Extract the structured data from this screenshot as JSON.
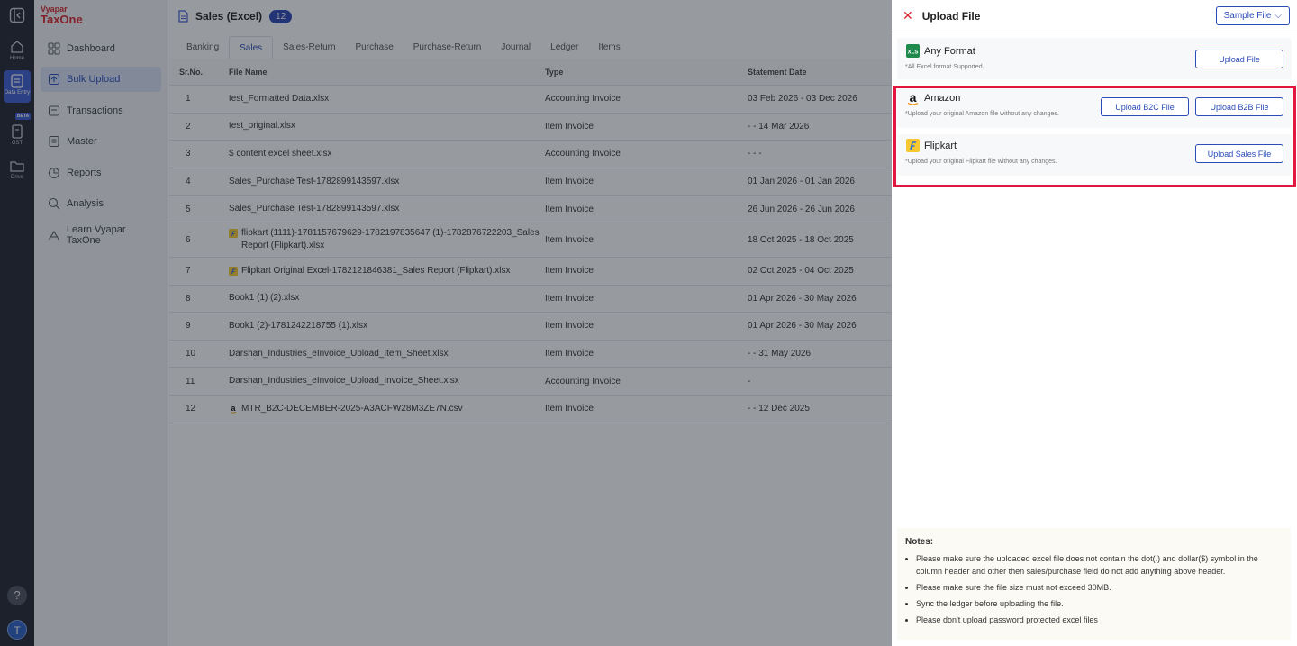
{
  "rail": {
    "items": [
      {
        "label": "Home"
      },
      {
        "label": "Data Entry"
      },
      {
        "label": "GST"
      },
      {
        "label": "Drive"
      }
    ],
    "beta": "BETA",
    "help": "?",
    "avatar": "T"
  },
  "sidebar": {
    "logo_top": "Vyapar",
    "logo_bottom": "TaxOne",
    "items": [
      {
        "label": "Dashboard"
      },
      {
        "label": "Bulk Upload"
      },
      {
        "label": "Transactions"
      },
      {
        "label": "Master"
      },
      {
        "label": "Reports"
      },
      {
        "label": "Analysis"
      },
      {
        "label": "Learn Vyapar TaxOne"
      }
    ]
  },
  "main": {
    "title": "Sales (Excel)",
    "count": "12",
    "tabs": [
      "Banking",
      "Sales",
      "Sales-Return",
      "Purchase",
      "Purchase-Return",
      "Journal",
      "Ledger",
      "Items"
    ],
    "columns": [
      "Sr.No.",
      "File Name",
      "Type",
      "Statement Date"
    ],
    "rows": [
      {
        "sr": "1",
        "file": "test_Formatted Data.xlsx",
        "type": "Accounting Invoice",
        "date": "03 Feb 2026 - 03 Dec 2026",
        "icon": ""
      },
      {
        "sr": "2",
        "file": "test_original.xlsx",
        "type": "Item Invoice",
        "date": "- - 14 Mar 2026",
        "icon": ""
      },
      {
        "sr": "3",
        "file": "$ content excel sheet.xlsx",
        "type": "Accounting Invoice",
        "date": "- - -",
        "icon": ""
      },
      {
        "sr": "4",
        "file": "Sales_Purchase Test-1782899143597.xlsx",
        "type": "Item Invoice",
        "date": "01 Jan 2026 - 01 Jan 2026",
        "icon": ""
      },
      {
        "sr": "5",
        "file": "Sales_Purchase Test-1782899143597.xlsx",
        "type": "Item Invoice",
        "date": "26 Jun 2026 - 26 Jun 2026",
        "icon": ""
      },
      {
        "sr": "6",
        "file": "flipkart (1111)-1781157679629-1782197835647 (1)-1782876722203_Sales Report (Flipkart).xlsx",
        "type": "Item Invoice",
        "date": "18 Oct 2025 - 18 Oct 2025",
        "icon": "flipkart"
      },
      {
        "sr": "7",
        "file": "Flipkart Original Excel-1782121846381_Sales Report (Flipkart).xlsx",
        "type": "Item Invoice",
        "date": "02 Oct 2025 - 04 Oct 2025",
        "icon": "flipkart"
      },
      {
        "sr": "8",
        "file": "Book1 (1) (2).xlsx",
        "type": "Item Invoice",
        "date": "01 Apr 2026 - 30 May 2026",
        "icon": ""
      },
      {
        "sr": "9",
        "file": "Book1 (2)-1781242218755 (1).xlsx",
        "type": "Item Invoice",
        "date": "01 Apr 2026 - 30 May 2026",
        "icon": ""
      },
      {
        "sr": "10",
        "file": "Darshan_Industries_eInvoice_Upload_Item_Sheet.xlsx",
        "type": "Item Invoice",
        "date": "- - 31 May 2026",
        "icon": ""
      },
      {
        "sr": "11",
        "file": "Darshan_Industries_eInvoice_Upload_Invoice_Sheet.xlsx",
        "type": "Accounting Invoice",
        "date": "-",
        "icon": ""
      },
      {
        "sr": "12",
        "file": "MTR_B2C-DECEMBER-2025-A3ACFW28M3ZE7N.csv",
        "type": "Item Invoice",
        "date": "- - 12 Dec 2025",
        "icon": "amazon"
      }
    ]
  },
  "panel": {
    "title": "Upload File",
    "sample_label": "Sample File",
    "any_format": {
      "name": "Any Format",
      "hint": "*All Excel format Supported.",
      "button": "Upload File"
    },
    "amazon": {
      "name": "Amazon",
      "hint": "*Upload your original Amazon file without any changes.",
      "button_b2c": "Upload B2C File",
      "button_b2b": "Upload B2B File"
    },
    "flipkart": {
      "name": "Flipkart",
      "hint": "*Upload your original Flipkart file without any changes.",
      "button": "Upload Sales File"
    },
    "notes": {
      "title": "Notes:",
      "items": [
        "Please make sure the uploaded excel file does not contain the dot(.) and dollar($) symbol in the column header and other then sales/purchase field do not add anything above header.",
        "Please make sure the file size must not exceed 30MB.",
        "Sync the ledger before uploading the file.",
        "Please don't upload password protected excel files"
      ]
    }
  },
  "colors": {
    "accent": "#2a4bb8",
    "highlight": "#e3163f",
    "brand": "#d8262e"
  }
}
